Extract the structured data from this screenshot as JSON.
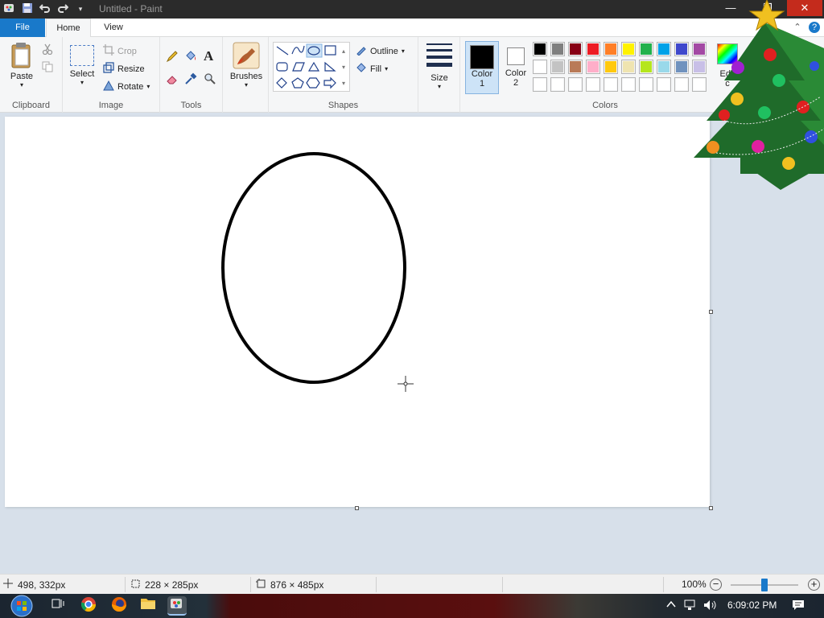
{
  "titlebar": {
    "title": "Untitled - Paint",
    "minimize_glyph": "—",
    "maximize_glyph": "❐",
    "close_glyph": "✕"
  },
  "tabs": {
    "file": "File",
    "home": "Home",
    "view": "View"
  },
  "clipboard": {
    "paste": "Paste",
    "group": "Clipboard"
  },
  "image": {
    "select": "Select",
    "crop": "Crop",
    "resize": "Resize",
    "rotate": "Rotate",
    "group": "Image"
  },
  "tools": {
    "group": "Tools",
    "text_glyph": "A"
  },
  "brushes": {
    "label": "Brushes"
  },
  "shapes": {
    "outline": "Outline",
    "fill": "Fill",
    "group": "Shapes"
  },
  "size": {
    "label": "Size"
  },
  "colors": {
    "color1_line1": "Color",
    "color1_line2": "1",
    "color2_line1": "Color",
    "color2_line2": "2",
    "edit_line1": "Edit",
    "edit_line2": "c",
    "group": "Colors",
    "color1_value": "#000000",
    "color2_value": "#ffffff",
    "palette_row1": [
      "#000000",
      "#7f7f7f",
      "#880015",
      "#ed1c24",
      "#ff7f27",
      "#fff200",
      "#22b14c",
      "#00a2e8",
      "#3f48cc",
      "#a349a4"
    ],
    "palette_row2": [
      "#ffffff",
      "#c3c3c3",
      "#b97a57",
      "#ffaec9",
      "#ffc90e",
      "#efe4b0",
      "#b5e61d",
      "#99d9ea",
      "#7092be",
      "#c8bfe7"
    ],
    "palette_row3": [
      "#ffffff",
      "#ffffff",
      "#ffffff",
      "#ffffff",
      "#ffffff",
      "#ffffff",
      "#ffffff",
      "#ffffff",
      "#ffffff",
      "#ffffff"
    ]
  },
  "status": {
    "cursor_pos": "498, 332px",
    "selection_size": "228 × 285px",
    "canvas_size": "876 × 485px",
    "zoom": "100%",
    "zoom_fraction": 0.5
  },
  "taskbar": {
    "time": "6:09:02 PM"
  }
}
